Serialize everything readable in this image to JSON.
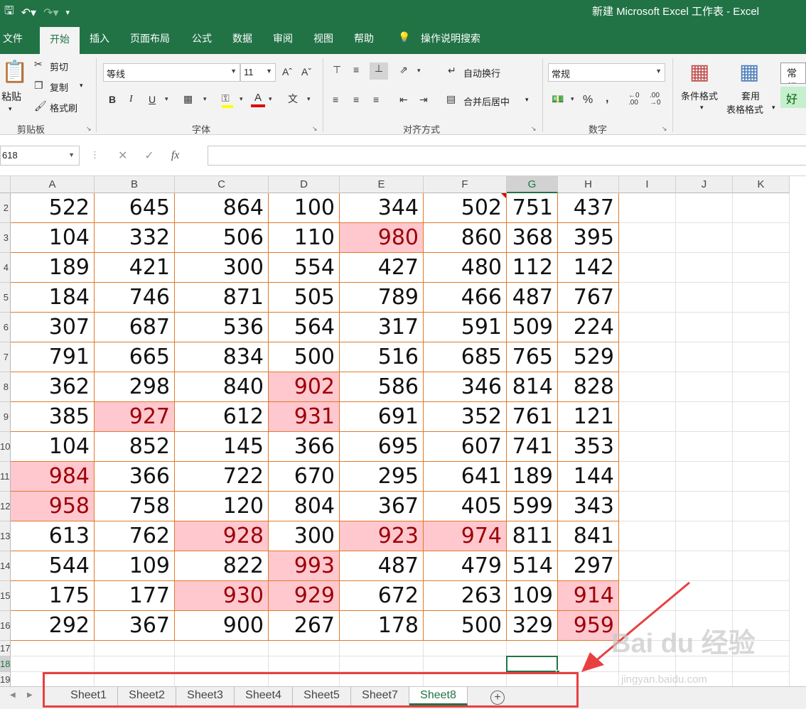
{
  "titlebar": {
    "title": "新建 Microsoft Excel 工作表  -  Excel",
    "save_icon": "save-icon",
    "undo_icon": "undo-icon",
    "redo_icon": "redo-icon"
  },
  "tabs": [
    "文件",
    "开始",
    "插入",
    "页面布局",
    "公式",
    "数据",
    "审阅",
    "视图",
    "帮助",
    "操作说明搜索"
  ],
  "ribbon": {
    "clipboard": {
      "paste": "粘贴",
      "cut": "剪切",
      "copy": "复制",
      "format_painter": "格式刷",
      "label": "剪贴板"
    },
    "font": {
      "name": "等线",
      "size": "11",
      "bold": "B",
      "italic": "I",
      "underline": "U",
      "label": "字体"
    },
    "alignment": {
      "wrap": "自动换行",
      "merge": "合并后居中",
      "label": "对齐方式"
    },
    "number": {
      "format": "常规",
      "label": "数字"
    },
    "styles": {
      "conditional": "条件格式",
      "table_1": "套用",
      "table_2": "表格格式",
      "normal": "常规",
      "good": "好"
    }
  },
  "formula_bar": {
    "name_box": "618",
    "fx": "fx",
    "content": ""
  },
  "columns": [
    "A",
    "B",
    "C",
    "D",
    "E",
    "F",
    "G",
    "H",
    "I",
    "J",
    "K"
  ],
  "selected_column": "G",
  "rows": [
    {
      "num": "2",
      "cells": [
        "522",
        "645",
        "864",
        "100",
        "344",
        "502",
        "751",
        "437"
      ],
      "hl": []
    },
    {
      "num": "3",
      "cells": [
        "104",
        "332",
        "506",
        "110",
        "980",
        "860",
        "368",
        "395"
      ],
      "hl": [
        4
      ]
    },
    {
      "num": "4",
      "cells": [
        "189",
        "421",
        "300",
        "554",
        "427",
        "480",
        "112",
        "142"
      ],
      "hl": []
    },
    {
      "num": "5",
      "cells": [
        "184",
        "746",
        "871",
        "505",
        "789",
        "466",
        "487",
        "767"
      ],
      "hl": []
    },
    {
      "num": "6",
      "cells": [
        "307",
        "687",
        "536",
        "564",
        "317",
        "591",
        "509",
        "224"
      ],
      "hl": []
    },
    {
      "num": "7",
      "cells": [
        "791",
        "665",
        "834",
        "500",
        "516",
        "685",
        "765",
        "529"
      ],
      "hl": []
    },
    {
      "num": "8",
      "cells": [
        "362",
        "298",
        "840",
        "902",
        "586",
        "346",
        "814",
        "828"
      ],
      "hl": [
        3
      ]
    },
    {
      "num": "9",
      "cells": [
        "385",
        "927",
        "612",
        "931",
        "691",
        "352",
        "761",
        "121"
      ],
      "hl": [
        1,
        3
      ]
    },
    {
      "num": "10",
      "cells": [
        "104",
        "852",
        "145",
        "366",
        "695",
        "607",
        "741",
        "353"
      ],
      "hl": []
    },
    {
      "num": "11",
      "cells": [
        "984",
        "366",
        "722",
        "670",
        "295",
        "641",
        "189",
        "144"
      ],
      "hl": [
        0
      ]
    },
    {
      "num": "12",
      "cells": [
        "958",
        "758",
        "120",
        "804",
        "367",
        "405",
        "599",
        "343"
      ],
      "hl": [
        0
      ]
    },
    {
      "num": "13",
      "cells": [
        "613",
        "762",
        "928",
        "300",
        "923",
        "974",
        "811",
        "841"
      ],
      "hl": [
        2,
        4,
        5
      ]
    },
    {
      "num": "14",
      "cells": [
        "544",
        "109",
        "822",
        "993",
        "487",
        "479",
        "514",
        "297"
      ],
      "hl": [
        3
      ]
    },
    {
      "num": "15",
      "cells": [
        "175",
        "177",
        "930",
        "929",
        "672",
        "263",
        "109",
        "914"
      ],
      "hl": [
        2,
        3,
        7
      ]
    },
    {
      "num": "16",
      "cells": [
        "292",
        "367",
        "900",
        "267",
        "178",
        "500",
        "329",
        "959"
      ],
      "hl": [
        7
      ]
    }
  ],
  "empty_rows": [
    "17",
    "18",
    "19"
  ],
  "selected_row": "18",
  "sheets": [
    "Sheet1",
    "Sheet2",
    "Sheet3",
    "Sheet4",
    "Sheet5",
    "Sheet7",
    "Sheet8"
  ],
  "active_sheet": "Sheet8",
  "colors": {
    "excel_green": "#217346",
    "highlight_fill": "#ffc7ce",
    "highlight_text": "#9c0006",
    "annotation_red": "#e84040"
  },
  "watermark": {
    "text": "Bai du 经验",
    "url": "jingyan.baidu.com"
  }
}
